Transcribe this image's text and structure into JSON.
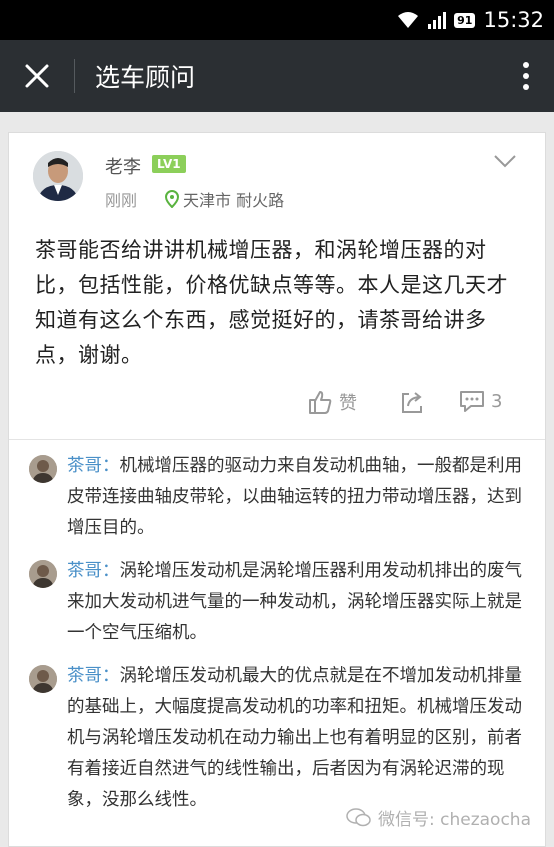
{
  "status_bar": {
    "time": "15:32",
    "battery": "91"
  },
  "app_bar": {
    "title": "选车顾问"
  },
  "post": {
    "author": "老李",
    "level": "LV1",
    "time": "刚刚",
    "location": "天津市 耐火路",
    "body": "茶哥能否给讲讲机械增压器，和涡轮增压器的对比，包括性能，价格优缺点等等。本人是这几天才知道有这么个东西，感觉挺好的，请茶哥给讲多点，谢谢。",
    "like_label": "赞",
    "comment_count": "3"
  },
  "comments": [
    {
      "author": "茶哥：",
      "text": "机械增压器的驱动力来自发动机曲轴，一般都是利用皮带连接曲轴皮带轮，以曲轴运转的扭力带动增压器，达到增压目的。"
    },
    {
      "author": "茶哥：",
      "text": "涡轮增压发动机是涡轮增压器利用发动机排出的废气来加大发动机进气量的一种发动机，涡轮增压器实际上就是一个空气压缩机。"
    },
    {
      "author": "茶哥：",
      "text": "涡轮增压发动机最大的优点就是在不增加发动机排量的基础上，大幅度提高发动机的功率和扭矩。机械增压发动机与涡轮增压发动机在动力输出上也有着明显的区别，前者有着接近自然进气的线性输出，后者因为有涡轮迟滞的现象，没那么线性。"
    }
  ],
  "watermark": "微信号: chezaocha"
}
